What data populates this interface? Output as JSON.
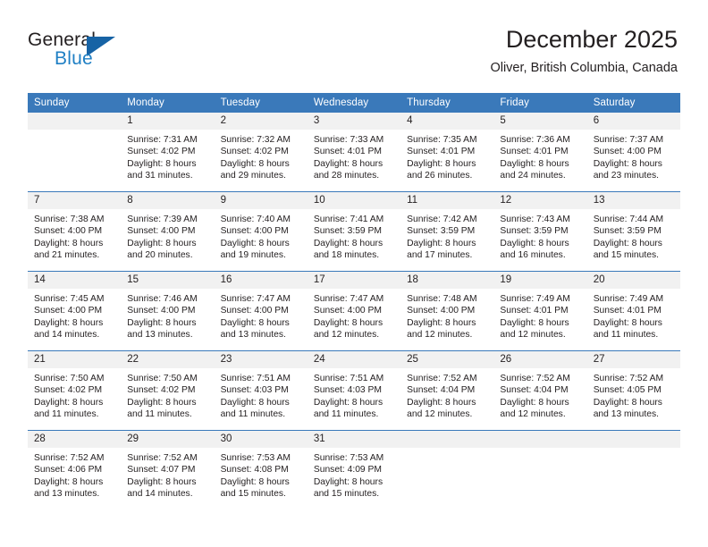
{
  "brand": {
    "name_part1": "General",
    "name_part2": "Blue",
    "triangle_icon": "triangle-icon",
    "accent_color": "#1763a5",
    "blue_text_color": "#1f7fc4"
  },
  "header": {
    "title": "December 2025",
    "location": "Oliver, British Columbia, Canada"
  },
  "calendar": {
    "header_bg": "#3a79ba",
    "daynum_bg": "#f1f1f1",
    "weekday_headers": [
      "Sunday",
      "Monday",
      "Tuesday",
      "Wednesday",
      "Thursday",
      "Friday",
      "Saturday"
    ],
    "weeks": [
      [
        {
          "day": "",
          "line1": "",
          "line2": "",
          "line3": "",
          "line4": ""
        },
        {
          "day": "1",
          "line1": "Sunrise: 7:31 AM",
          "line2": "Sunset: 4:02 PM",
          "line3": "Daylight: 8 hours",
          "line4": "and 31 minutes."
        },
        {
          "day": "2",
          "line1": "Sunrise: 7:32 AM",
          "line2": "Sunset: 4:02 PM",
          "line3": "Daylight: 8 hours",
          "line4": "and 29 minutes."
        },
        {
          "day": "3",
          "line1": "Sunrise: 7:33 AM",
          "line2": "Sunset: 4:01 PM",
          "line3": "Daylight: 8 hours",
          "line4": "and 28 minutes."
        },
        {
          "day": "4",
          "line1": "Sunrise: 7:35 AM",
          "line2": "Sunset: 4:01 PM",
          "line3": "Daylight: 8 hours",
          "line4": "and 26 minutes."
        },
        {
          "day": "5",
          "line1": "Sunrise: 7:36 AM",
          "line2": "Sunset: 4:01 PM",
          "line3": "Daylight: 8 hours",
          "line4": "and 24 minutes."
        },
        {
          "day": "6",
          "line1": "Sunrise: 7:37 AM",
          "line2": "Sunset: 4:00 PM",
          "line3": "Daylight: 8 hours",
          "line4": "and 23 minutes."
        }
      ],
      [
        {
          "day": "7",
          "line1": "Sunrise: 7:38 AM",
          "line2": "Sunset: 4:00 PM",
          "line3": "Daylight: 8 hours",
          "line4": "and 21 minutes."
        },
        {
          "day": "8",
          "line1": "Sunrise: 7:39 AM",
          "line2": "Sunset: 4:00 PM",
          "line3": "Daylight: 8 hours",
          "line4": "and 20 minutes."
        },
        {
          "day": "9",
          "line1": "Sunrise: 7:40 AM",
          "line2": "Sunset: 4:00 PM",
          "line3": "Daylight: 8 hours",
          "line4": "and 19 minutes."
        },
        {
          "day": "10",
          "line1": "Sunrise: 7:41 AM",
          "line2": "Sunset: 3:59 PM",
          "line3": "Daylight: 8 hours",
          "line4": "and 18 minutes."
        },
        {
          "day": "11",
          "line1": "Sunrise: 7:42 AM",
          "line2": "Sunset: 3:59 PM",
          "line3": "Daylight: 8 hours",
          "line4": "and 17 minutes."
        },
        {
          "day": "12",
          "line1": "Sunrise: 7:43 AM",
          "line2": "Sunset: 3:59 PM",
          "line3": "Daylight: 8 hours",
          "line4": "and 16 minutes."
        },
        {
          "day": "13",
          "line1": "Sunrise: 7:44 AM",
          "line2": "Sunset: 3:59 PM",
          "line3": "Daylight: 8 hours",
          "line4": "and 15 minutes."
        }
      ],
      [
        {
          "day": "14",
          "line1": "Sunrise: 7:45 AM",
          "line2": "Sunset: 4:00 PM",
          "line3": "Daylight: 8 hours",
          "line4": "and 14 minutes."
        },
        {
          "day": "15",
          "line1": "Sunrise: 7:46 AM",
          "line2": "Sunset: 4:00 PM",
          "line3": "Daylight: 8 hours",
          "line4": "and 13 minutes."
        },
        {
          "day": "16",
          "line1": "Sunrise: 7:47 AM",
          "line2": "Sunset: 4:00 PM",
          "line3": "Daylight: 8 hours",
          "line4": "and 13 minutes."
        },
        {
          "day": "17",
          "line1": "Sunrise: 7:47 AM",
          "line2": "Sunset: 4:00 PM",
          "line3": "Daylight: 8 hours",
          "line4": "and 12 minutes."
        },
        {
          "day": "18",
          "line1": "Sunrise: 7:48 AM",
          "line2": "Sunset: 4:00 PM",
          "line3": "Daylight: 8 hours",
          "line4": "and 12 minutes."
        },
        {
          "day": "19",
          "line1": "Sunrise: 7:49 AM",
          "line2": "Sunset: 4:01 PM",
          "line3": "Daylight: 8 hours",
          "line4": "and 12 minutes."
        },
        {
          "day": "20",
          "line1": "Sunrise: 7:49 AM",
          "line2": "Sunset: 4:01 PM",
          "line3": "Daylight: 8 hours",
          "line4": "and 11 minutes."
        }
      ],
      [
        {
          "day": "21",
          "line1": "Sunrise: 7:50 AM",
          "line2": "Sunset: 4:02 PM",
          "line3": "Daylight: 8 hours",
          "line4": "and 11 minutes."
        },
        {
          "day": "22",
          "line1": "Sunrise: 7:50 AM",
          "line2": "Sunset: 4:02 PM",
          "line3": "Daylight: 8 hours",
          "line4": "and 11 minutes."
        },
        {
          "day": "23",
          "line1": "Sunrise: 7:51 AM",
          "line2": "Sunset: 4:03 PM",
          "line3": "Daylight: 8 hours",
          "line4": "and 11 minutes."
        },
        {
          "day": "24",
          "line1": "Sunrise: 7:51 AM",
          "line2": "Sunset: 4:03 PM",
          "line3": "Daylight: 8 hours",
          "line4": "and 11 minutes."
        },
        {
          "day": "25",
          "line1": "Sunrise: 7:52 AM",
          "line2": "Sunset: 4:04 PM",
          "line3": "Daylight: 8 hours",
          "line4": "and 12 minutes."
        },
        {
          "day": "26",
          "line1": "Sunrise: 7:52 AM",
          "line2": "Sunset: 4:04 PM",
          "line3": "Daylight: 8 hours",
          "line4": "and 12 minutes."
        },
        {
          "day": "27",
          "line1": "Sunrise: 7:52 AM",
          "line2": "Sunset: 4:05 PM",
          "line3": "Daylight: 8 hours",
          "line4": "and 13 minutes."
        }
      ],
      [
        {
          "day": "28",
          "line1": "Sunrise: 7:52 AM",
          "line2": "Sunset: 4:06 PM",
          "line3": "Daylight: 8 hours",
          "line4": "and 13 minutes."
        },
        {
          "day": "29",
          "line1": "Sunrise: 7:52 AM",
          "line2": "Sunset: 4:07 PM",
          "line3": "Daylight: 8 hours",
          "line4": "and 14 minutes."
        },
        {
          "day": "30",
          "line1": "Sunrise: 7:53 AM",
          "line2": "Sunset: 4:08 PM",
          "line3": "Daylight: 8 hours",
          "line4": "and 15 minutes."
        },
        {
          "day": "31",
          "line1": "Sunrise: 7:53 AM",
          "line2": "Sunset: 4:09 PM",
          "line3": "Daylight: 8 hours",
          "line4": "and 15 minutes."
        },
        {
          "day": "",
          "line1": "",
          "line2": "",
          "line3": "",
          "line4": ""
        },
        {
          "day": "",
          "line1": "",
          "line2": "",
          "line3": "",
          "line4": ""
        },
        {
          "day": "",
          "line1": "",
          "line2": "",
          "line3": "",
          "line4": ""
        }
      ]
    ]
  }
}
